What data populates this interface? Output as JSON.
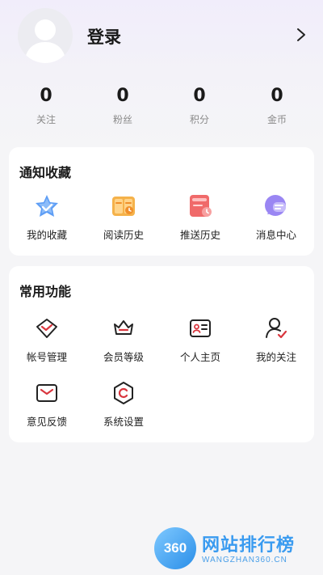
{
  "profile": {
    "login_label": "登录"
  },
  "stats": [
    {
      "value": "0",
      "label": "关注"
    },
    {
      "value": "0",
      "label": "粉丝"
    },
    {
      "value": "0",
      "label": "积分"
    },
    {
      "value": "0",
      "label": "金币"
    }
  ],
  "notify_section": {
    "title": "通知收藏",
    "items": [
      {
        "label": "我的收藏",
        "icon": "star-icon"
      },
      {
        "label": "阅读历史",
        "icon": "book-icon"
      },
      {
        "label": "推送历史",
        "icon": "push-history-icon"
      },
      {
        "label": "消息中心",
        "icon": "message-icon"
      }
    ]
  },
  "common_section": {
    "title": "常用功能",
    "items": [
      {
        "label": "帐号管理",
        "icon": "account-icon"
      },
      {
        "label": "会员等级",
        "icon": "crown-icon"
      },
      {
        "label": "个人主页",
        "icon": "id-card-icon"
      },
      {
        "label": "我的关注",
        "icon": "user-follow-icon"
      },
      {
        "label": "意见反馈",
        "icon": "mail-icon"
      },
      {
        "label": "系统设置",
        "icon": "settings-icon"
      }
    ]
  },
  "watermark": {
    "logo_text": "360",
    "title": "网站排行榜",
    "subtitle": "WANGZHAN360.CN"
  },
  "colors": {
    "accent_red": "#d9363e",
    "icon_blue": "#4a8cf0",
    "icon_orange": "#f3a33a",
    "icon_red": "#ef5656",
    "icon_purple": "#8f7cf0"
  }
}
